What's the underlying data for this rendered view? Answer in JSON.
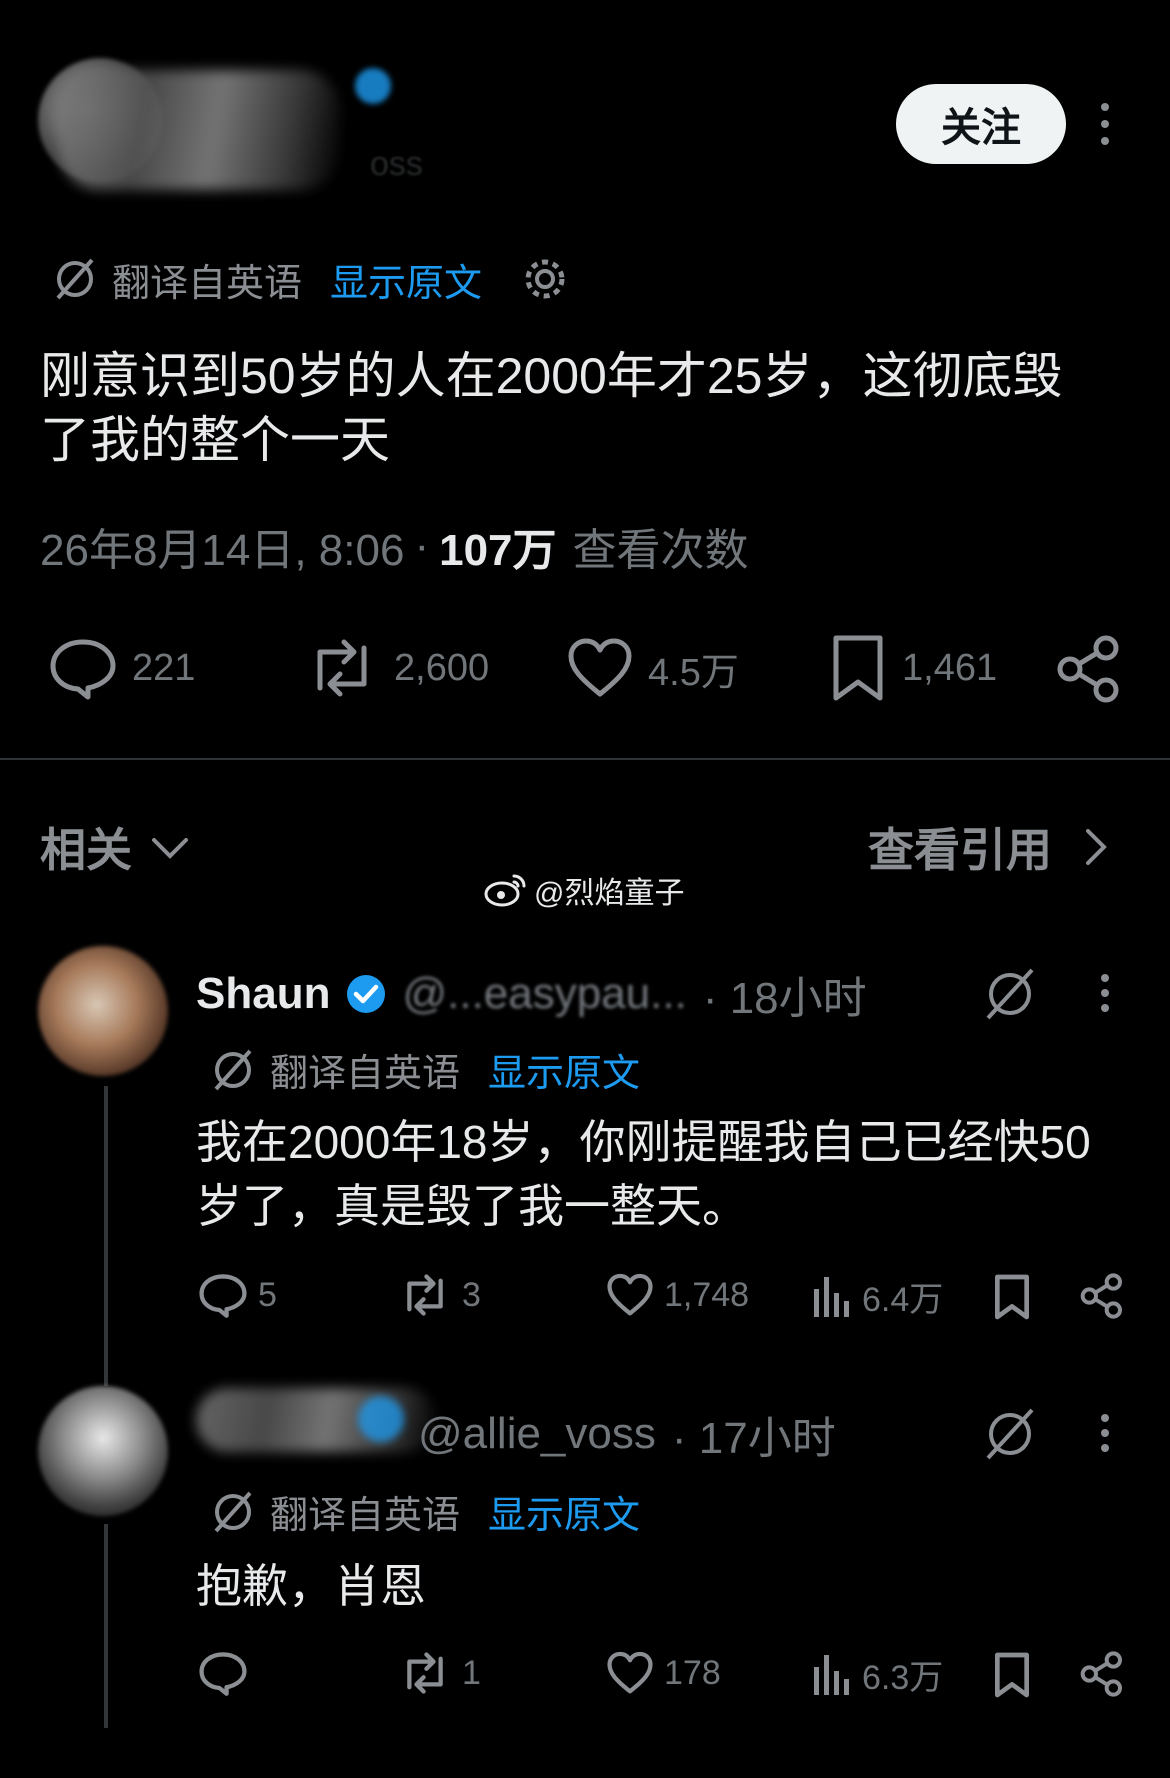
{
  "post": {
    "handle_fragment": "oss",
    "follow_label": "关注",
    "translated_label": "翻译自英语",
    "show_original_label": "显示原文",
    "text": "刚意识到50岁的人在2000年才25岁，这彻底毁了我的整个一天",
    "date": "26年8月14日, 8:06",
    "separator": "·",
    "views_count": "107万",
    "views_label": "查看次数",
    "stats": {
      "replies": "221",
      "reposts": "2,600",
      "likes": "4.5万",
      "bookmarks": "1,461"
    }
  },
  "section": {
    "related_label": "相关",
    "view_quotes_label": "查看引用"
  },
  "watermark": "@烈焰童子",
  "replies": [
    {
      "name": "Shaun",
      "handle": "@...easypau...",
      "time": "· 18小时",
      "translated_label": "翻译自英语",
      "show_original_label": "显示原文",
      "text": "我在2000年18岁，你刚提醒我自己已经快50岁了，真是毁了我一整天。",
      "stats": {
        "replies": "5",
        "reposts": "3",
        "likes": "1,748",
        "views": "6.4万"
      }
    },
    {
      "name": "",
      "handle": "@allie_voss",
      "time": "· 17小时",
      "translated_label": "翻译自英语",
      "show_original_label": "显示原文",
      "text": "抱歉，肖恩",
      "stats": {
        "replies": "",
        "reposts": "1",
        "likes": "178",
        "views": "6.3万"
      }
    }
  ],
  "colors": {
    "background": "#000000",
    "text": "#e7e9ea",
    "muted": "#71767b",
    "link": "#1d9bf0",
    "verified": "#1d9bf0"
  }
}
